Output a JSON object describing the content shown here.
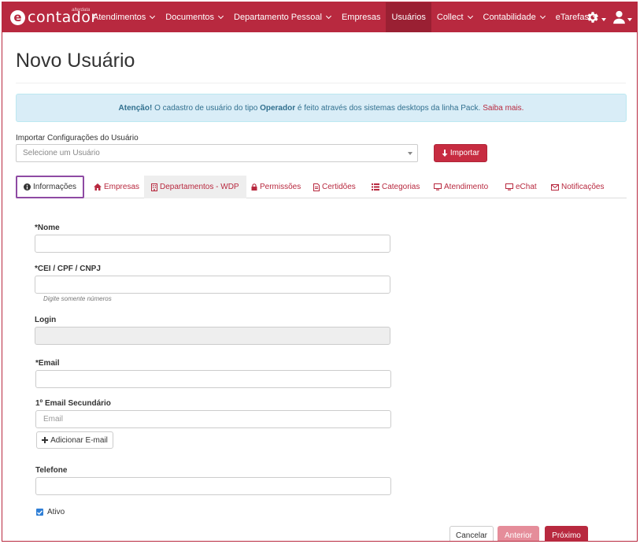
{
  "brand": {
    "word": "contador",
    "tag": "alterdata"
  },
  "nav": {
    "items": [
      {
        "label": "Atendimentos",
        "has_dropdown": true
      },
      {
        "label": "Documentos",
        "has_dropdown": true
      },
      {
        "label": "Departamento Pessoal",
        "has_dropdown": true
      },
      {
        "label": "Empresas",
        "has_dropdown": false
      },
      {
        "label": "Usuários",
        "has_dropdown": false,
        "active": true
      },
      {
        "label": "Collect",
        "has_dropdown": true
      },
      {
        "label": "Contabilidade",
        "has_dropdown": true
      },
      {
        "label": "eTarefas",
        "has_dropdown": true
      }
    ],
    "right_icons": [
      "gear-icon",
      "user-icon"
    ]
  },
  "page": {
    "title": "Novo Usuário"
  },
  "alert": {
    "prefix": "Atenção!",
    "text1": "O cadastro de usuário do tipo",
    "bold": "Operador",
    "text2": "é feito através dos sistemas desktops da linha Pack.",
    "link": "Saiba mais."
  },
  "import": {
    "label": "Importar Configurações do Usuário",
    "select_placeholder": "Selecione um Usuário",
    "button": "Importar"
  },
  "tabs": [
    {
      "label": "Informações",
      "icon": "info-icon",
      "active": true
    },
    {
      "label": "Empresas",
      "icon": "home-icon"
    },
    {
      "label": "Departamentos - WDP",
      "icon": "building-icon"
    },
    {
      "label": "Permissões",
      "icon": "lock-icon"
    },
    {
      "label": "Certidões",
      "icon": "document-icon"
    },
    {
      "label": "Categorias",
      "icon": "list-icon"
    },
    {
      "label": "Atendimento",
      "icon": "monitor-icon"
    },
    {
      "label": "eChat",
      "icon": "monitor-icon"
    },
    {
      "label": "Notificações",
      "icon": "envelope-icon"
    }
  ],
  "form": {
    "nome_label": "*Nome",
    "cpf_label": "*CEI / CPF / CNPJ",
    "cpf_help": "Digite somente números",
    "login_label": "Login",
    "email_label": "*Email",
    "email2_label": "1º Email Secundário",
    "email2_placeholder": "Email",
    "add_email": "Adicionar E-mail",
    "telefone_label": "Telefone",
    "ativo_label": "Ativo",
    "ativo_checked": true
  },
  "footer": {
    "cancel": "Cancelar",
    "prev": "Anterior",
    "next": "Próximo"
  },
  "colors": {
    "brand": "#b8293f",
    "active_nav": "#9a2033",
    "alert_bg": "#d9edf7",
    "tab_focus": "#8e4aa3"
  }
}
